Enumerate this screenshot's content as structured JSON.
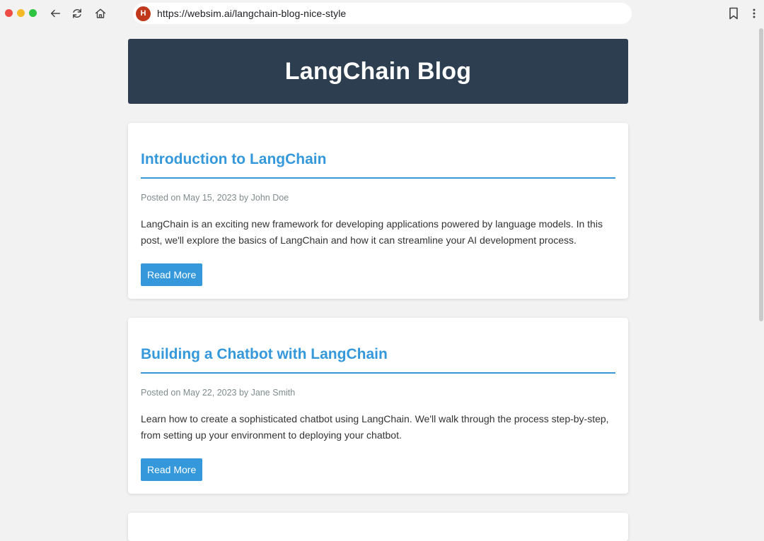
{
  "browser": {
    "url": "https://websim.ai/langchain-blog-nice-style",
    "site_badge": "H",
    "icons": {
      "back": "back-arrow-icon",
      "reload": "reload-icon",
      "home": "home-icon",
      "bookmark": "bookmark-icon",
      "menu": "kebab-menu-icon"
    }
  },
  "colors": {
    "header_bg": "#2c3e50",
    "accent": "#3498db",
    "meta_text": "#7f8c8d",
    "body_text": "#333333",
    "page_bg": "#f2f2f2"
  },
  "header": {
    "title": "LangChain Blog"
  },
  "posts": [
    {
      "title": "Introduction to LangChain",
      "meta": "Posted on May 15, 2023 by John Doe",
      "excerpt": "LangChain is an exciting new framework for developing applications powered by language models. In this post, we'll explore the basics of LangChain and how it can streamline your AI development process.",
      "button": "Read More"
    },
    {
      "title": "Building a Chatbot with LangChain",
      "meta": "Posted on May 22, 2023 by Jane Smith",
      "excerpt": "Learn how to create a sophisticated chatbot using LangChain. We'll walk through the process step-by-step, from setting up your environment to deploying your chatbot.",
      "button": "Read More"
    }
  ]
}
